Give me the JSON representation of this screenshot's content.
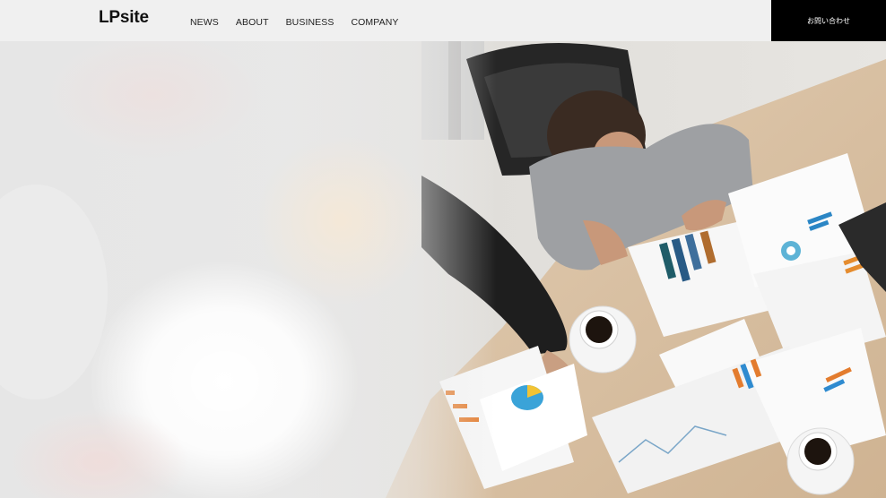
{
  "header": {
    "logo": "LPsite",
    "nav": [
      {
        "label": "NEWS"
      },
      {
        "label": "ABOUT"
      },
      {
        "label": "BUSINESS"
      },
      {
        "label": "COMPANY"
      }
    ],
    "contact_label": "お問い合わせ"
  },
  "colors": {
    "header_bg": "#f0f0f0",
    "contact_bg": "#000000",
    "contact_text": "#ffffff",
    "desk": "#d9c3a8"
  }
}
